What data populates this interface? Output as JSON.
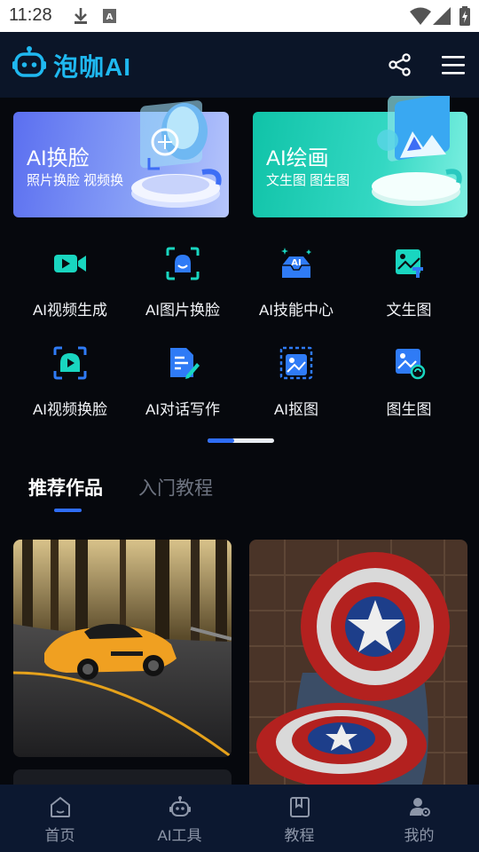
{
  "status_bar": {
    "time": "11:28",
    "icons": [
      "download-icon",
      "app-a-icon",
      "wifi-icon",
      "signal-icon",
      "battery-icon"
    ]
  },
  "app_bar": {
    "title": "泡咖AI",
    "accent": "#1fb8f0",
    "icons": [
      "robot-logo-icon",
      "share-icon",
      "menu-icon"
    ]
  },
  "banners": [
    {
      "title": "AI换脸",
      "subtitle": "照片换脸 视频换"
    },
    {
      "title": "AI绘画",
      "subtitle": "文生图 图生图"
    }
  ],
  "tools": [
    {
      "label": "AI视频生成",
      "icon": "video-camera-icon"
    },
    {
      "label": "AI图片换脸",
      "icon": "face-scan-icon"
    },
    {
      "label": "AI技能中心",
      "icon": "ai-inbox-icon"
    },
    {
      "label": "文生图",
      "icon": "text-to-image-icon"
    },
    {
      "label": "AI视频换脸",
      "icon": "video-face-icon"
    },
    {
      "label": "AI对话写作",
      "icon": "document-edit-icon"
    },
    {
      "label": "AI抠图",
      "icon": "cutout-image-icon"
    },
    {
      "label": "图生图",
      "icon": "image-to-image-icon"
    }
  ],
  "tabs": [
    {
      "label": "推荐作品",
      "active": true
    },
    {
      "label": "入门教程",
      "active": false
    }
  ],
  "bottom_nav": [
    {
      "label": "首页",
      "icon": "home-icon"
    },
    {
      "label": "AI工具",
      "icon": "robot-icon"
    },
    {
      "label": "教程",
      "icon": "book-icon"
    },
    {
      "label": "我的",
      "icon": "user-settings-icon"
    }
  ],
  "colors": {
    "background": "#06080d",
    "primary": "#2f6df6",
    "tool_icon_teal": "#19d6c0",
    "tool_icon_blue": "#2f7bf6"
  }
}
